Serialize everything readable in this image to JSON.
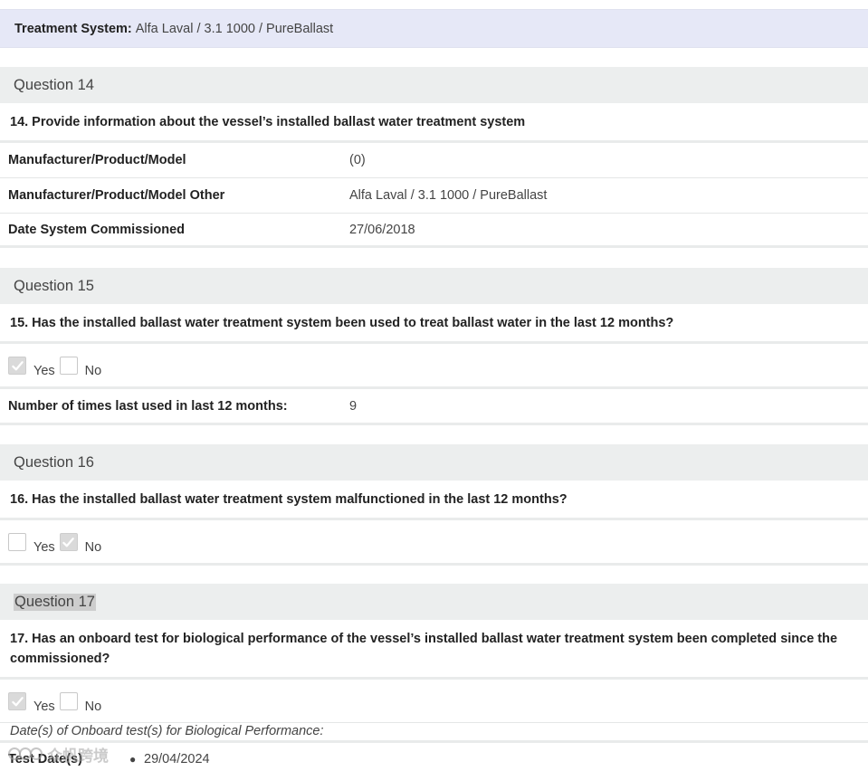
{
  "treatment": {
    "label": "Treatment System:",
    "value": "Alfa Laval / 3.1 1000 / PureBallast"
  },
  "q14": {
    "header": "Question 14",
    "text": "14. Provide information about the vessel’s installed ballast water treatment system",
    "rows": [
      {
        "label": "Manufacturer/Product/Model",
        "value": "(0)"
      },
      {
        "label": "Manufacturer/Product/Model Other",
        "value": "Alfa Laval / 3.1 1000 / PureBallast"
      },
      {
        "label": "Date System Commissioned",
        "value": "27/06/2018"
      }
    ]
  },
  "q15": {
    "header": "Question 15",
    "text": "15. Has the installed ballast water treatment system been used to treat ballast water in the last 12 months?",
    "yes_label": "Yes",
    "no_label": "No",
    "yes_checked": true,
    "no_checked": false,
    "times_label": "Number of times last used in last 12 months:",
    "times_value": "9"
  },
  "q16": {
    "header": "Question 16",
    "text": "16. Has the installed ballast water treatment system malfunctioned in the last 12 months?",
    "yes_label": "Yes",
    "no_label": "No",
    "yes_checked": false,
    "no_checked": true
  },
  "q17": {
    "header": "Question 17",
    "text_line1": "17. Has an onboard test for biological performance of the vessel’s installed ballast water treatment system been completed since the",
    "text_line2": "commissioned?",
    "yes_label": "Yes",
    "no_label": "No",
    "yes_checked": true,
    "no_checked": false,
    "dates_note": "Date(s) of Onboard test(s) for Biological Performance:",
    "test_label": "Test Date(s)",
    "test_dates": [
      "29/04/2024"
    ]
  },
  "watermark": {
    "text": "众帆跨境"
  },
  "icons": {
    "checkbox_check": "check-icon",
    "watermark_logo": "watermark-logo-icon"
  }
}
